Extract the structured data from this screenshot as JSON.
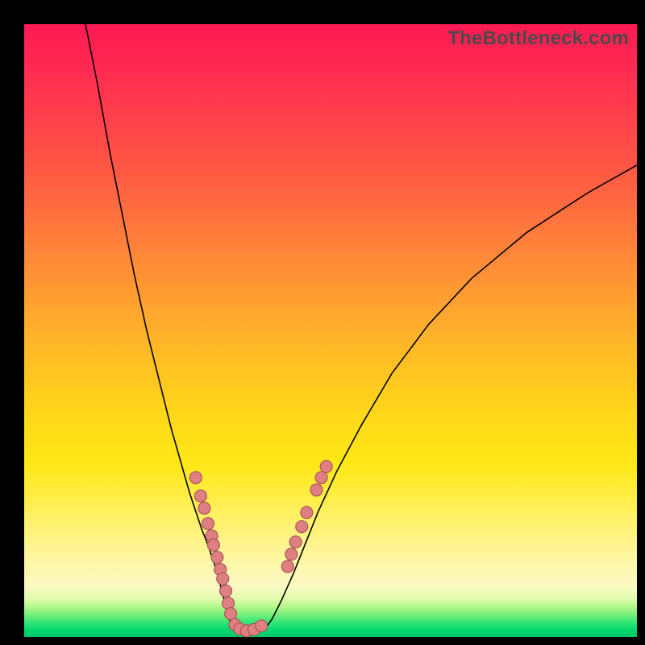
{
  "watermark": "TheBottleneck.com",
  "colors": {
    "dot_fill": "#e07f82",
    "dot_stroke": "#aa5658",
    "curve_stroke": "#000000",
    "frame_bg": "#000000",
    "gradient_stops": [
      {
        "pos": 0.0,
        "color": "#ff1a53"
      },
      {
        "pos": 0.5,
        "color": "#ffb02b"
      },
      {
        "pos": 0.8,
        "color": "#fff274"
      },
      {
        "pos": 0.95,
        "color": "#6cef77"
      },
      {
        "pos": 1.0,
        "color": "#06c964"
      }
    ]
  },
  "chart_data": {
    "type": "line",
    "title": "",
    "xlabel": "",
    "ylabel": "",
    "xlim": [
      0,
      100
    ],
    "ylim": [
      0,
      100
    ],
    "legend": false,
    "grid": false,
    "series": [
      {
        "name": "left-branch",
        "x": [
          10,
          12,
          14,
          16,
          18,
          20,
          22,
          24,
          26,
          27,
          28,
          29,
          30,
          31,
          31.5,
          32,
          32.5,
          33,
          33.5
        ],
        "y": [
          100,
          90,
          79,
          69,
          59,
          50,
          42,
          34,
          27,
          23.5,
          20.5,
          17.5,
          15,
          12,
          10.5,
          8.5,
          6.5,
          4.5,
          2.8
        ]
      },
      {
        "name": "valley",
        "x": [
          33.5,
          34.2,
          35,
          36,
          37,
          38,
          39,
          39.8,
          40.5
        ],
        "y": [
          2.8,
          1.6,
          1.0,
          0.6,
          0.6,
          0.8,
          1.3,
          2.0,
          3.0
        ]
      },
      {
        "name": "right-branch",
        "x": [
          40.5,
          42,
          44,
          46,
          48,
          51,
          55,
          60,
          66,
          73,
          82,
          92,
          100
        ],
        "y": [
          3.0,
          6.0,
          10.5,
          15.5,
          20.5,
          27,
          34.5,
          43,
          51,
          58.5,
          66,
          72.5,
          77
        ]
      }
    ],
    "dots_left": [
      {
        "x": 28.0,
        "y": 26.0
      },
      {
        "x": 28.8,
        "y": 23.0
      },
      {
        "x": 29.4,
        "y": 21.0
      },
      {
        "x": 30.0,
        "y": 18.5
      },
      {
        "x": 30.6,
        "y": 16.5
      },
      {
        "x": 30.9,
        "y": 15.0
      },
      {
        "x": 31.5,
        "y": 13.0
      },
      {
        "x": 32.0,
        "y": 11.0
      },
      {
        "x": 32.4,
        "y": 9.5
      },
      {
        "x": 32.9,
        "y": 7.5
      },
      {
        "x": 33.3,
        "y": 5.5
      },
      {
        "x": 33.7,
        "y": 3.8
      }
    ],
    "dots_valley": [
      {
        "x": 34.4,
        "y": 2.0
      },
      {
        "x": 35.2,
        "y": 1.3
      },
      {
        "x": 36.3,
        "y": 1.0
      },
      {
        "x": 37.5,
        "y": 1.2
      },
      {
        "x": 38.7,
        "y": 1.8
      }
    ],
    "dots_right": [
      {
        "x": 43.0,
        "y": 11.5
      },
      {
        "x": 43.6,
        "y": 13.5
      },
      {
        "x": 44.3,
        "y": 15.5
      },
      {
        "x": 45.3,
        "y": 18.0
      },
      {
        "x": 46.1,
        "y": 20.3
      },
      {
        "x": 47.7,
        "y": 24.0
      },
      {
        "x": 48.5,
        "y": 26.0
      },
      {
        "x": 49.3,
        "y": 27.8
      }
    ],
    "dot_radius_px": 7.5
  }
}
